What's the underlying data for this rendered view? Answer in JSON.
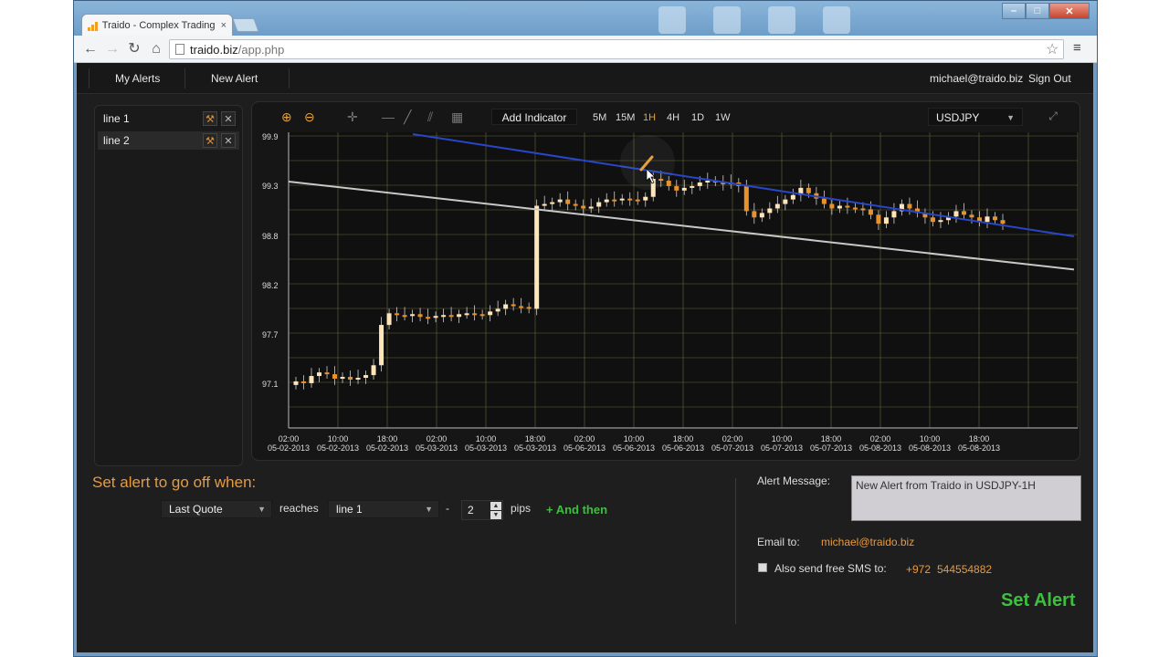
{
  "browser": {
    "tab_title": "Traido - Complex Trading",
    "tab_close": "×",
    "url_host": "traido.biz",
    "url_path": "/app.php",
    "back_glyph": "←",
    "forward_glyph": "→",
    "reload_glyph": "↻",
    "home_glyph": "⌂",
    "star_glyph": "☆",
    "menu_glyph": "≡",
    "min_glyph": "–",
    "max_glyph": "□",
    "close_glyph": "✕"
  },
  "header": {
    "my_alerts": "My Alerts",
    "new_alert": "New Alert",
    "user_email": "michael@traido.biz",
    "sign_out": "Sign Out"
  },
  "sidebar": {
    "items": [
      {
        "label": "line 1",
        "active": false
      },
      {
        "label": "line 2",
        "active": true
      }
    ],
    "wrench_glyph": "⚒",
    "close_glyph": "✕"
  },
  "toolbar": {
    "zoom_in": "⊕",
    "zoom_out": "⊖",
    "crosshair": "✛",
    "hline": "—",
    "trendline": "╱",
    "channel": "⫽",
    "fib": "▦",
    "add_indicator": "Add Indicator",
    "timeframes": [
      "5M",
      "15M",
      "1H",
      "4H",
      "1D",
      "1W"
    ],
    "selected_timeframe": "1H",
    "symbol": "USDJPY",
    "dropdown_glyph": "▼",
    "expand_glyph": "⤢"
  },
  "chart_data": {
    "type": "candlestick",
    "symbol": "USDJPY",
    "timeframe": "1H",
    "y_ticks": [
      "99.9",
      "99.3",
      "98.8",
      "98.2",
      "97.7",
      "97.1"
    ],
    "ylim": [
      96.6,
      99.9
    ],
    "x_ticks": [
      {
        "time": "02:00",
        "date": "05-02-2013"
      },
      {
        "time": "10:00",
        "date": "05-02-2013"
      },
      {
        "time": "18:00",
        "date": "05-02-2013"
      },
      {
        "time": "02:00",
        "date": "05-03-2013"
      },
      {
        "time": "10:00",
        "date": "05-03-2013"
      },
      {
        "time": "18:00",
        "date": "05-03-2013"
      },
      {
        "time": "02:00",
        "date": "05-06-2013"
      },
      {
        "time": "10:00",
        "date": "05-06-2013"
      },
      {
        "time": "18:00",
        "date": "05-06-2013"
      },
      {
        "time": "02:00",
        "date": "05-07-2013"
      },
      {
        "time": "10:00",
        "date": "05-07-2013"
      },
      {
        "time": "18:00",
        "date": "05-07-2013"
      },
      {
        "time": "02:00",
        "date": "05-08-2013"
      },
      {
        "time": "10:00",
        "date": "05-08-2013"
      },
      {
        "time": "18:00",
        "date": "05-08-2013"
      }
    ],
    "price_path": [
      97.12,
      97.1,
      97.18,
      97.22,
      97.2,
      97.15,
      97.17,
      97.14,
      97.16,
      97.19,
      97.3,
      97.75,
      97.88,
      97.86,
      97.85,
      97.87,
      97.84,
      97.83,
      97.85,
      97.86,
      97.84,
      97.87,
      97.88,
      97.87,
      97.86,
      97.9,
      97.93,
      97.98,
      97.96,
      97.95,
      97.93,
      99.08,
      99.1,
      99.12,
      99.15,
      99.1,
      99.08,
      99.05,
      99.07,
      99.12,
      99.15,
      99.14,
      99.16,
      99.15,
      99.14,
      99.18,
      99.38,
      99.36,
      99.3,
      99.25,
      99.28,
      99.3,
      99.34,
      99.36,
      99.35,
      99.32,
      99.34,
      99.3,
      99.02,
      98.95,
      99.0,
      99.05,
      99.1,
      99.15,
      99.2,
      99.28,
      99.22,
      99.16,
      99.1,
      99.05,
      99.08,
      99.06,
      99.05,
      99.04,
      98.98,
      98.88,
      98.95,
      99.02,
      99.1,
      99.05,
      99.0,
      98.95,
      98.9,
      98.92,
      98.96,
      99.02,
      98.98,
      98.95,
      98.9,
      98.96,
      98.92,
      98.88
    ],
    "trendlines": [
      {
        "name": "line 1",
        "color": "#c8c8c8",
        "from": {
          "i": 0,
          "y": 99.35
        },
        "to": {
          "i": 91,
          "y": 98.45
        }
      },
      {
        "name": "line 2",
        "color": "#2846c8",
        "from": {
          "i": 16,
          "y": 99.88
        },
        "to": {
          "i": 91,
          "y": 98.82
        }
      }
    ],
    "up_color": "#ffe6b8",
    "down_color": "#e8922c",
    "grid": true,
    "grid_color": "#8a8a48"
  },
  "alert_form": {
    "title": "Set alert to go off when:",
    "quote_select": "Last Quote",
    "reaches_label": "reaches",
    "line_select": "line 1",
    "dash": "-",
    "pips_value": "2",
    "pips_label": "pips",
    "and_then": "+ And then",
    "spin_up": "▲",
    "spin_down": "▼"
  },
  "alert_settings": {
    "message_label": "Alert Message:",
    "message_value": "New Alert from Traido in USDJPY-1H",
    "email_label": "Email to:",
    "email_value": "michael@traido.biz",
    "sms_label": "Also send free SMS to:",
    "sms_country": "+972",
    "sms_number": "544554882",
    "submit": "Set Alert"
  }
}
